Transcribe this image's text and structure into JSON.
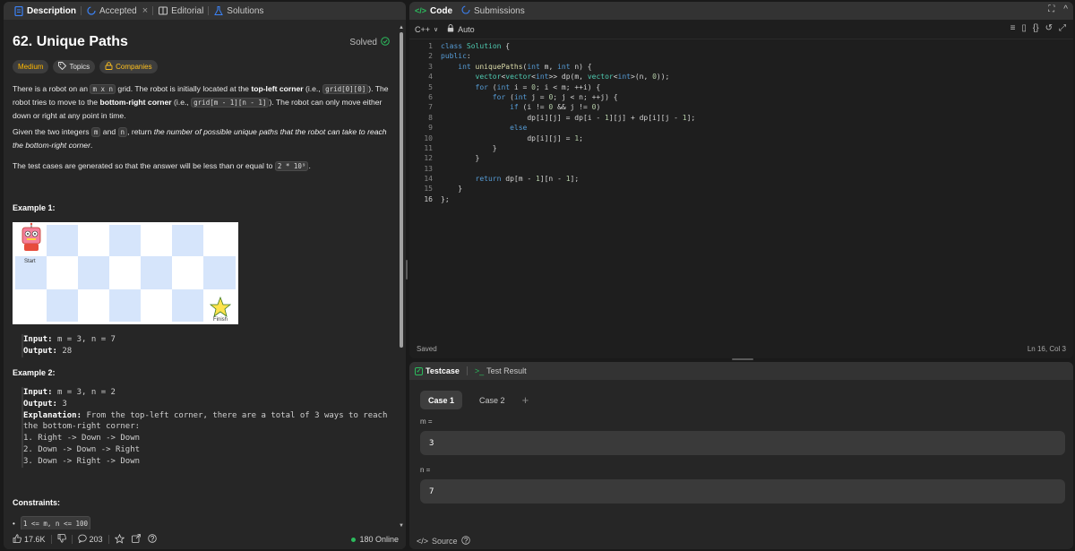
{
  "left_tabs": [
    {
      "label": "Description",
      "icon": "document-icon",
      "active": true
    },
    {
      "label": "Accepted",
      "icon": "history-icon",
      "active": false,
      "close": "×"
    },
    {
      "label": "Editorial",
      "icon": "book-icon",
      "active": false
    },
    {
      "label": "Solutions",
      "icon": "flask-icon",
      "active": false
    }
  ],
  "problem": {
    "title": "62. Unique Paths",
    "status": "Solved",
    "chips": {
      "difficulty": "Medium",
      "topics": "Topics",
      "companies": "Companies"
    },
    "p1_a": "There is a robot on an ",
    "p1_code1": "m x n",
    "p1_b": " grid. The robot is initially located at the ",
    "p1_bold1": "top-left corner",
    "p1_c": " (i.e., ",
    "p1_code2": "grid[0][0]",
    "p1_d": "). The robot tries to move to the ",
    "p1_bold2": "bottom-right corner",
    "p1_e": " (i.e., ",
    "p1_code3": "grid[m - 1][n - 1]",
    "p1_f": "). The robot can only move either down or right at any point in time.",
    "p2_a": "Given the two integers ",
    "p2_code1": "m",
    "p2_b": " and ",
    "p2_code2": "n",
    "p2_c": ", return ",
    "p2_italic": "the number of possible unique paths that the robot can take to reach the bottom-right corner",
    "p2_d": ".",
    "p3_a": "The test cases are generated so that the answer will be less than or equal to ",
    "p3_code": "2 * 10⁹",
    "p3_b": ".",
    "example1_heading": "Example 1:",
    "grid_start_label": "Start",
    "grid_finish_label": "Finish",
    "ex1": {
      "input_key": "Input:",
      "input_val": "m = 3, n = 7",
      "output_key": "Output:",
      "output_val": "28"
    },
    "example2_heading": "Example 2:",
    "ex2": {
      "input_key": "Input:",
      "input_val": "m = 3, n = 2",
      "output_key": "Output:",
      "output_val": "3",
      "expl_key": "Explanation:",
      "expl_val": "From the top-left corner, there are a total of 3 ways to reach",
      "expl_line2": "the bottom-right corner:",
      "steps": [
        "1. Right -> Down -> Down",
        "2. Down -> Down -> Right",
        "3. Down -> Right -> Down"
      ]
    },
    "constraints_heading": "Constraints:",
    "constraint1": "1 <= m, n <= 100"
  },
  "left_footer": {
    "likes": "17.6K",
    "comments": "203",
    "online": "180 Online"
  },
  "code_tabs": [
    {
      "label": "Code",
      "icon": "code-icon",
      "active": true
    },
    {
      "label": "Submissions",
      "icon": "history-icon",
      "active": false
    }
  ],
  "code_toolbar": {
    "language": "C++",
    "mode": "Auto"
  },
  "code_lines": [
    "class Solution {",
    "public:",
    "    int uniquePaths(int m, int n) {",
    "        vector<vector<int>> dp(m, vector<int>(n, 0));",
    "        for (int i = 0; i < m; ++i) {",
    "            for (int j = 0; j < n; ++j) {",
    "                if (i != 0 && j != 0)",
    "                    dp[i][j] = dp[i - 1][j] + dp[i][j - 1];",
    "                else",
    "                    dp[i][j] = 1;",
    "            }",
    "        }",
    "",
    "        return dp[m - 1][n - 1];",
    "    }",
    "};"
  ],
  "code_status": {
    "saved": "Saved",
    "cursor": "Ln 16, Col 3"
  },
  "test_tabs": [
    {
      "label": "Testcase",
      "active": true
    },
    {
      "label": "Test Result",
      "active": false
    }
  ],
  "cases": [
    "Case 1",
    "Case 2"
  ],
  "vars": [
    {
      "name": "m =",
      "value": "3"
    },
    {
      "name": "n =",
      "value": "7"
    }
  ],
  "test_footer": {
    "source": "Source"
  },
  "colors": {
    "accent_green": "#2cbb5d",
    "medium": "#ffb800",
    "background": "#1a1a1a",
    "panel": "#262626"
  }
}
